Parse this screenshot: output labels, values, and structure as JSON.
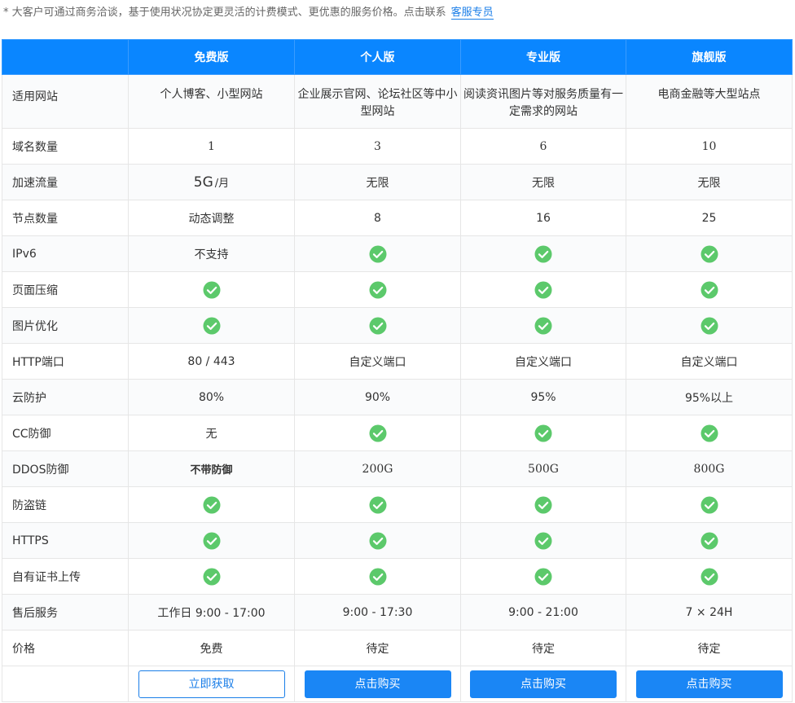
{
  "notice": {
    "text": "* 大客户可通过商务洽谈，基于使用状况协定更灵活的计费模式、更优惠的服务价格。点击联系",
    "link": "客服专员"
  },
  "plans": [
    "免费版",
    "个人版",
    "专业版",
    "旗舰版"
  ],
  "rows": {
    "sites": {
      "label": "适用网站",
      "values": [
        "个人博客、小型网站",
        "企业展示官网、论坛社区等中小型网站",
        "阅读资讯图片等对服务质量有一定需求的网站",
        "电商金融等大型站点"
      ]
    },
    "domains": {
      "label": "域名数量",
      "values": [
        "1",
        "3",
        "6",
        "10"
      ]
    },
    "traffic": {
      "label": "加速流量",
      "free_value": "5G",
      "free_unit": "/月",
      "values": [
        "无限",
        "无限",
        "无限"
      ]
    },
    "nodes": {
      "label": "节点数量",
      "values": [
        "动态调整",
        "8",
        "16",
        "25"
      ]
    },
    "ipv6": {
      "label": "IPv6",
      "free_value": "不支持"
    },
    "compress": {
      "label": "页面压缩"
    },
    "image_opt": {
      "label": "图片优化"
    },
    "http_port": {
      "label": "HTTP端口",
      "values": [
        "80 / 443",
        "自定义端口",
        "自定义端口",
        "自定义端口"
      ]
    },
    "cloud_protect": {
      "label": "云防护",
      "values": [
        "80%",
        "90%",
        "95%",
        "95%以上"
      ]
    },
    "cc": {
      "label": "CC防御",
      "free_value": "无"
    },
    "ddos": {
      "label": "DDOS防御",
      "values": [
        "不带防御",
        "200G",
        "500G",
        "800G"
      ]
    },
    "hotlink": {
      "label": "防盗链"
    },
    "https": {
      "label": "HTTPS"
    },
    "cert": {
      "label": "自有证书上传"
    },
    "support": {
      "label": "售后服务",
      "values": [
        "工作日 9:00 - 17:00",
        "9:00 - 17:30",
        "9:00 - 21:00",
        "7 × 24H"
      ]
    },
    "price": {
      "label": "价格",
      "values": [
        "免费",
        "待定",
        "待定",
        "待定"
      ]
    }
  },
  "buttons": {
    "free": "立即获取",
    "buy": "点击购买"
  },
  "colors": {
    "header_bg": "#0a86ff",
    "check": "#5cc96b",
    "button": "#1a86f5",
    "link": "#1a7ee8"
  },
  "icons": {
    "check": "check-circle-icon"
  }
}
